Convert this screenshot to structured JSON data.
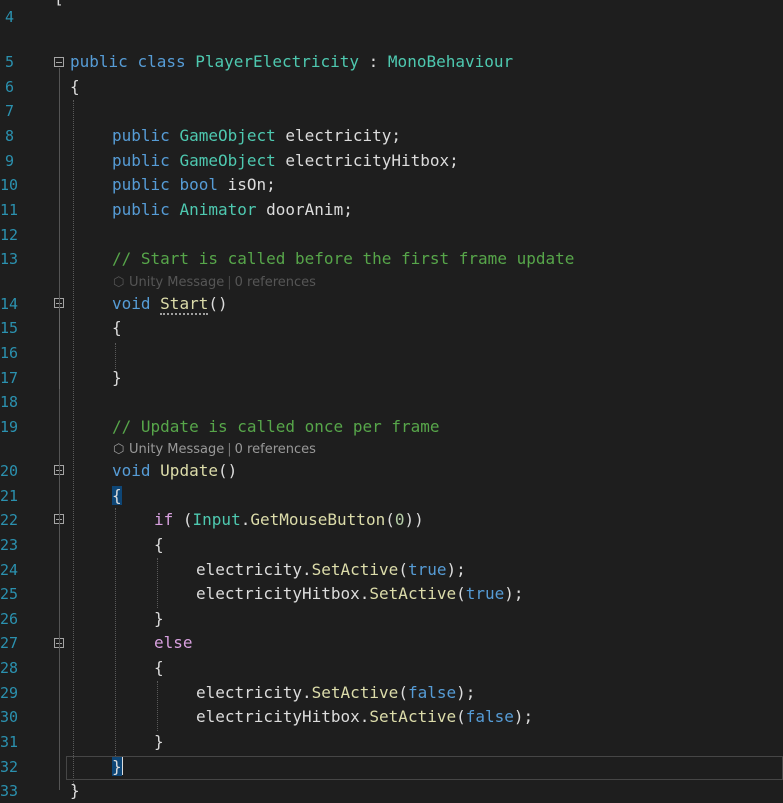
{
  "editor": {
    "line_numbers": [
      "4",
      "5",
      "6",
      "7",
      "8",
      "9",
      "10",
      "11",
      "12",
      "13",
      "14",
      "15",
      "16",
      "17",
      "18",
      "19",
      "20",
      "21",
      "22",
      "23",
      "24",
      "25",
      "26",
      "27",
      "28",
      "29",
      "30",
      "31",
      "32",
      "33"
    ],
    "class_decl": {
      "kw1": "public",
      "kw2": "class",
      "name": "PlayerElectricity",
      "colon": " : ",
      "base": "MonoBehaviour"
    },
    "open_class": "{",
    "fields": [
      {
        "mod": "public",
        "type": "GameObject",
        "name": " electricity;"
      },
      {
        "mod": "public",
        "type": "GameObject",
        "name": " electricityHitbox;"
      },
      {
        "mod": "public",
        "type": "bool",
        "name": " isOn;"
      },
      {
        "mod": "public",
        "type": "Animator",
        "name": " doorAnim;"
      }
    ],
    "comment_start": "// Start is called before the first frame update",
    "comment_update": "// Update is called once per frame",
    "codelens": {
      "unity": "Unity Message",
      "refs": "0 references"
    },
    "start_method": {
      "ret": "void",
      "name": "Start",
      "parens": "()"
    },
    "update_method": {
      "ret": "void",
      "name": "Update",
      "parens": "()"
    },
    "if_line": {
      "kw": "if",
      "open": " (",
      "obj": "Input",
      "dot": ".",
      "method": "GetMouseButton",
      "arg_open": "(",
      "arg": "0",
      "close": "))"
    },
    "else_kw": "else",
    "calls_true": [
      {
        "obj": "electricity",
        "method": "SetActive",
        "arg": "true"
      },
      {
        "obj": "electricityHitbox",
        "method": "SetActive",
        "arg": "true"
      }
    ],
    "calls_false": [
      {
        "obj": "electricity",
        "method": "SetActive",
        "arg": "false"
      },
      {
        "obj": "electricityHitbox",
        "method": "SetActive",
        "arg": "false"
      }
    ],
    "brace_open": "{",
    "brace_close": "}"
  }
}
